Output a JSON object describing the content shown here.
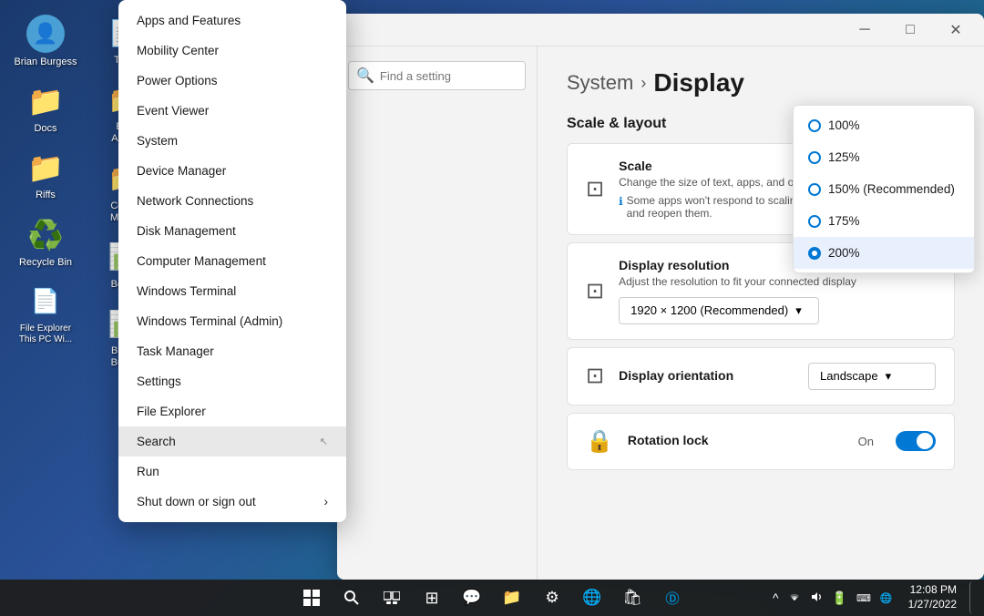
{
  "desktop": {
    "background": "linear-gradient(135deg, #1a3a6c 0%, #2a5298 40%, #1a6b8a 70%, #0d4f6b 100%)"
  },
  "desktop_icons": [
    {
      "id": "user",
      "emoji": "👤",
      "label": "Brian Burgess",
      "color": "#4a9fd4"
    },
    {
      "id": "docs",
      "emoji": "📁",
      "label": "Docs",
      "color": "#f5c518"
    },
    {
      "id": "riffs",
      "emoji": "📁",
      "label": "Riffs",
      "color": "#f5c518"
    },
    {
      "id": "recycle",
      "emoji": "🗑️",
      "label": "Recycle Bin",
      "color": "#aaa"
    },
    {
      "id": "file_explorer",
      "emoji": "📄",
      "label": "File Explorer\nThis PC Wi...",
      "color": "white"
    }
  ],
  "context_menu": {
    "items": [
      {
        "id": "apps",
        "label": "Apps and Features"
      },
      {
        "id": "mobility",
        "label": "Mobility Center"
      },
      {
        "id": "power",
        "label": "Power Options"
      },
      {
        "id": "event",
        "label": "Event Viewer"
      },
      {
        "id": "system",
        "label": "System"
      },
      {
        "id": "device",
        "label": "Device Manager"
      },
      {
        "id": "network",
        "label": "Network Connections"
      },
      {
        "id": "disk",
        "label": "Disk Management"
      },
      {
        "id": "computer",
        "label": "Computer Management"
      },
      {
        "id": "terminal",
        "label": "Windows Terminal"
      },
      {
        "id": "terminal_admin",
        "label": "Windows Terminal (Admin)"
      },
      {
        "id": "task",
        "label": "Task Manager"
      },
      {
        "id": "settings",
        "label": "Settings"
      },
      {
        "id": "file_exp",
        "label": "File Explorer"
      },
      {
        "id": "search",
        "label": "Search",
        "highlighted": true
      },
      {
        "id": "run",
        "label": "Run"
      },
      {
        "id": "shutdown",
        "label": "Shut down or sign out",
        "arrow": "›"
      }
    ]
  },
  "settings_window": {
    "title": "System > Display",
    "breadcrumb_system": "System",
    "breadcrumb_sep": ">",
    "breadcrumb_display": "Display",
    "section_scale_layout": "Scale & layout",
    "scale_card": {
      "name": "Scale",
      "desc": "Change the size of text, apps, and other items",
      "note": "Some apps won't respond to scaling changes until you close and reopen them."
    },
    "resolution_card": {
      "name": "Display resolution",
      "desc": "Adjust the resolution to fit your connected display",
      "value": "1920 × 1200 (Recommended)"
    },
    "orientation_card": {
      "name": "Display orientation",
      "value": "Landscape"
    },
    "rotation_lock_card": {
      "name": "Rotation lock",
      "status": "On"
    }
  },
  "scale_dropdown": {
    "options": [
      {
        "label": "100%",
        "selected": false
      },
      {
        "label": "125%",
        "selected": false
      },
      {
        "label": "150% (Recommended)",
        "selected": false
      },
      {
        "label": "175%",
        "selected": false
      },
      {
        "label": "200%",
        "selected": true
      }
    ]
  },
  "taskbar": {
    "icons": [
      {
        "id": "start",
        "symbol": "⊞",
        "label": "Start"
      },
      {
        "id": "search_tb",
        "symbol": "🔍",
        "label": "Search"
      },
      {
        "id": "task_view",
        "symbol": "⧉",
        "label": "Task View"
      },
      {
        "id": "widgets",
        "symbol": "▦",
        "label": "Widgets"
      },
      {
        "id": "teams",
        "symbol": "💬",
        "label": "Teams"
      },
      {
        "id": "explorer",
        "symbol": "📁",
        "label": "File Explorer"
      },
      {
        "id": "settings_tb",
        "symbol": "⚙",
        "label": "Settings"
      },
      {
        "id": "edge",
        "symbol": "🌐",
        "label": "Edge"
      },
      {
        "id": "store",
        "symbol": "🛍",
        "label": "Store"
      },
      {
        "id": "dell",
        "symbol": "Ⓓ",
        "label": "Dell"
      }
    ],
    "tray": {
      "chevron": "^",
      "wifi": "📶",
      "volume": "🔊",
      "battery": "🔋",
      "time": "12:08 PM",
      "date": "1/27/2022"
    }
  }
}
